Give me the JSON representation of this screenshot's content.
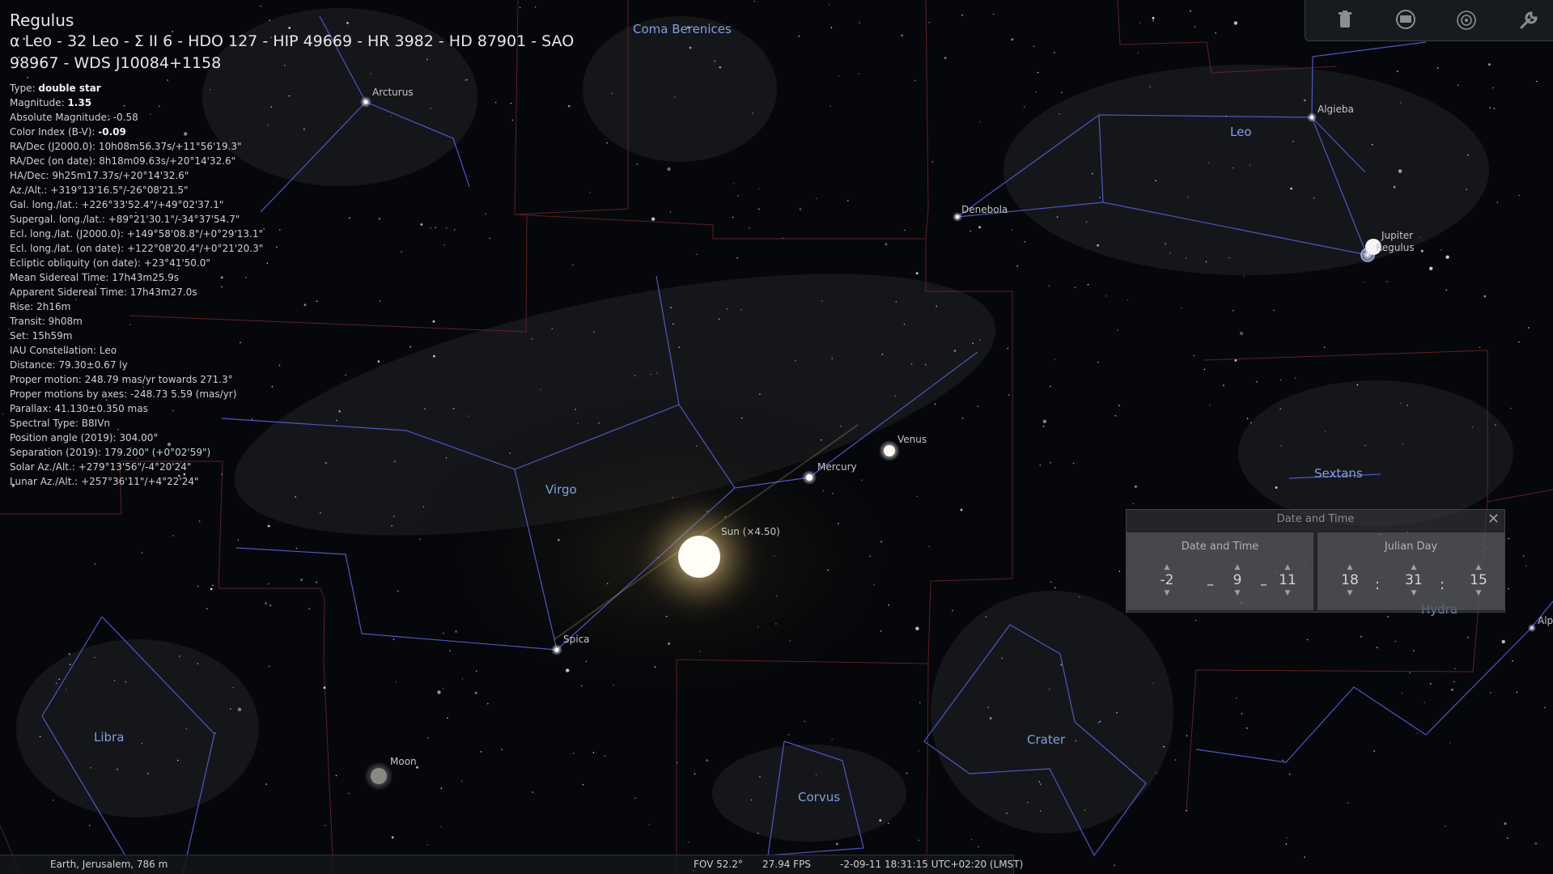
{
  "object": {
    "name": "Regulus",
    "designations": "α Leo - 32 Leo - Σ II 6 - HDO 127 - HIP 49669 - HR 3982 - HD 87901 - SAO 98967 - WDS J10084+1158",
    "details": [
      {
        "label": "Type: ",
        "value": "double star"
      },
      {
        "label": "Magnitude: ",
        "value": "1.35"
      },
      {
        "label": "Absolute Magnitude: ",
        "value": "-0.58"
      },
      {
        "label": "Color Index (B-V): ",
        "value": "-0.09"
      },
      {
        "label": "RA/Dec (J2000.0): ",
        "value": "10h08m56.37s/+11°56'19.3\""
      },
      {
        "label": "RA/Dec (on date): ",
        "value": "8h18m09.63s/+20°14'32.6\""
      },
      {
        "label": "HA/Dec: ",
        "value": "9h25m17.37s/+20°14'32.6\""
      },
      {
        "label": "Az./Alt.: ",
        "value": "+319°13'16.5\"/-26°08'21.5\""
      },
      {
        "label": "Gal. long./lat.: ",
        "value": "+226°33'52.4\"/+49°02'37.1\""
      },
      {
        "label": "Supergal. long./lat.: ",
        "value": "+89°21'30.1\"/-34°37'54.7\""
      },
      {
        "label": "Ecl. long./lat. (J2000.0): ",
        "value": "+149°58'08.8\"/+0°29'13.1\""
      },
      {
        "label": "Ecl. long./lat. (on date): ",
        "value": "+122°08'20.4\"/+0°21'20.3\""
      },
      {
        "label": "Ecliptic obliquity (on date): ",
        "value": "+23°41'50.0\""
      },
      {
        "label": "Mean Sidereal Time: ",
        "value": "17h43m25.9s"
      },
      {
        "label": "Apparent Sidereal Time: ",
        "value": "17h43m27.0s"
      },
      {
        "label": "Rise: ",
        "value": "2h16m"
      },
      {
        "label": "Transit: ",
        "value": "9h08m"
      },
      {
        "label": "Set: ",
        "value": "15h59m"
      },
      {
        "label": "IAU Constellation: ",
        "value": "Leo"
      },
      {
        "label": "Distance: ",
        "value": "79.30±0.67 ly"
      },
      {
        "label": "Proper motion: ",
        "value": "248.79 mas/yr towards 271.3°"
      },
      {
        "label": "Proper motions by axes: ",
        "value": "-248.73 5.59 (mas/yr)"
      },
      {
        "label": "Parallax: ",
        "value": "41.130±0.350 mas"
      },
      {
        "label": "Spectral Type: ",
        "value": "B8IVn"
      },
      {
        "label": "Position angle (2019): ",
        "value": "304.00°"
      },
      {
        "label": "Separation (2019): ",
        "value": "179.200\" (+0°02'59\")"
      },
      {
        "label": "Solar Az./Alt.: ",
        "value": "+279°13'56\"/-4°20'24\""
      },
      {
        "label": "Lunar Az./Alt.: ",
        "value": "+257°36'11\"/+4°22'24\""
      }
    ]
  },
  "sky_labels": {
    "constellations": [
      "Coma Berenices",
      "Leo",
      "Virgo",
      "Sextans",
      "Libra",
      "Corvus",
      "Crater",
      "Hydra"
    ],
    "objects": [
      "Arcturus",
      "Algieba",
      "Denebola",
      "Jupiter",
      "Regulus",
      "Mercury",
      "Venus",
      "Sun (×4.50)",
      "Spica",
      "Moon",
      "Alp"
    ]
  },
  "toolbar": {
    "icons": [
      "trash-icon",
      "screen-icon",
      "target-icon",
      "wrench-icon"
    ]
  },
  "date_time_window": {
    "title": "Date and Time",
    "close": "✕",
    "date_tab": "Date and Time",
    "julian_tab": "Julian Day",
    "year": "-2",
    "month": "9",
    "day": "11",
    "hour": "18",
    "minute": "31",
    "second": "15",
    "date_sep": "–",
    "time_sep": ":"
  },
  "status": {
    "location": "Earth, Jerusalem, 786 m",
    "fov": "FOV 52.2°",
    "fps": "27.94 FPS",
    "datetime": "-2-09-11 18:31:15 UTC+02:20 (LMST)"
  },
  "colors": {
    "constellation_line": "#5560c8",
    "boundary": "#8a2a2a",
    "constellation_label": "#7fa0e0",
    "star_label": "#c8c8c8",
    "sky": "#05070b"
  }
}
